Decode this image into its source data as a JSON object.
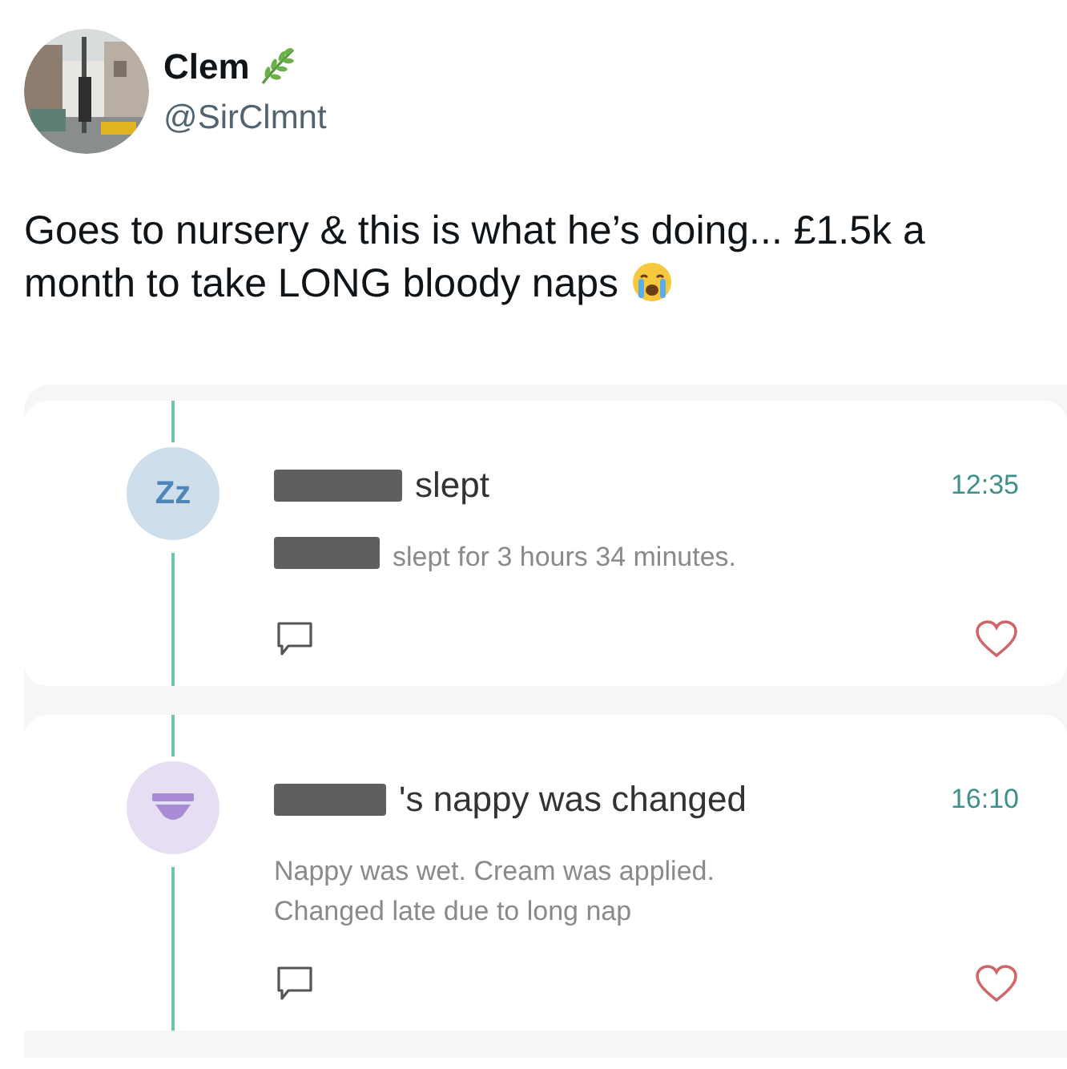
{
  "author": {
    "name": "Clem",
    "handle": "@SirClmnt"
  },
  "tweet": {
    "text": "Goes to nursery & this is what he’s doing... £1.5k a month to take LONG bloody naps"
  },
  "entries": [
    {
      "kind": "sleep",
      "icon_text": "Zz",
      "title": "slept",
      "time": "12:35",
      "detail": "slept for 3 hours 34 minutes.",
      "detail_redacted": true,
      "liked": false
    },
    {
      "kind": "nappy",
      "title": "'s nappy was changed",
      "time": "16:10",
      "detail": "Nappy was wet. Cream was applied. Changed late due to long nap",
      "detail_redacted": false,
      "liked": false
    }
  ]
}
